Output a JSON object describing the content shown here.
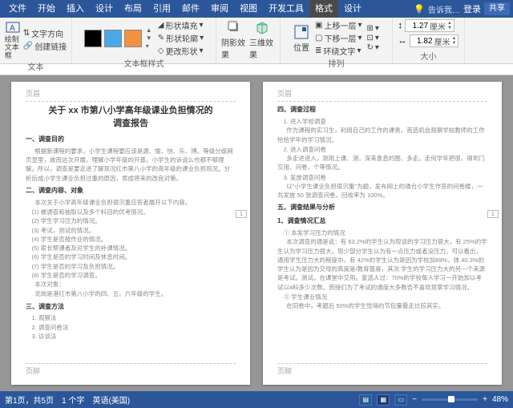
{
  "menu": {
    "tabs": [
      "文件",
      "开始",
      "插入",
      "设计",
      "布局",
      "引用",
      "邮件",
      "审阅",
      "视图",
      "开发工具",
      "格式",
      "设计"
    ],
    "tell": "告诉我…",
    "login": "登录",
    "share": "共享"
  },
  "ribbon": {
    "g1": {
      "btn1": "绘制\n文本框",
      "btn2": "创建链接",
      "txtdir": "文字方向",
      "label": "文本"
    },
    "g2": {
      "label": "文本框样式",
      "fill": "形状填充",
      "outline": "形状轮廓",
      "change": "更改形状"
    },
    "g3": {
      "shadow": "阴影效果",
      "threed": "三维效果"
    },
    "g4": {
      "pos": "位置",
      "up": "上移一层",
      "down": "下移一层",
      "wrap": "环绕文字",
      "label": "排列"
    },
    "g5": {
      "w": "1.27",
      "h": "1.82",
      "unit": "厘米",
      "label": "大小"
    }
  },
  "page1": {
    "hdr": "页眉",
    "ftr": "页脚",
    "title1": "关于 xx 市第八小学高年级课业负担情况的",
    "title2": "调查报告",
    "s1": "一、调查目的",
    "p1": "根据新课程的要求，小学生课程要应该是源、愉、快、乐、博。等级分级网页显里，故而这次开展，理解小学年级的开基。小学生的诉说么也都不够理解。所以，调查是要走进了解现况红市第八小学的高年级的课业负担现况。分析后成小学生课业负担过重的原因，思成将来的改良对策。",
    "s2": "二、调查内容、对象",
    "p2": "本次关于小学高年级课业负担很沉重应答者展开以下内容。",
    "l1": "(1) 被调查和抽取以及多个科目的优考情况。",
    "l2": "(2) 学生学习压力的情况。",
    "l3": "(3) 考试，测试的情况。",
    "l4": "(4) 学生是否按作业的情况。",
    "l5": "(5) 家长帮课者及对学生的补课情况。",
    "l6": "(6) 学生是否的学习时间及休息时间。",
    "l7": "(7) 学生是否的学习及负担情况。",
    "l8": "(8) 学生是否的学习调查。",
    "p3": "本次对象：",
    "p4": "龙岗是港红市第八小学的四、五、六年级的学生。",
    "s3": "三、调查方法",
    "l9": "1. 观察法",
    "l10": "2. 调查问卷法",
    "l11": "3. 访谈法"
  },
  "page2": {
    "hdr": "页眉",
    "ftr": "页脚",
    "s1": "四、调查过程",
    "l1": "1. 进入学校调查",
    "p1": "作为课程的实习生，利用自己的工作的课责，首选机会观察学校教师的工作恰恰学年的学习情况。",
    "l2": "2. 进入调查问卷",
    "p2": "多走进进入，测用上课、测，深来袁息的图、多走。走何学年把很，得到门交用、问卷，个等情况。",
    "l3": "3. 发放调查问卷",
    "p3": "以\"小学生课业负担很沉重\"为题，发布网上的通合小学生作答的问卷楼，一共发放 50 张调查问卷，回收率为 100%。",
    "s2": "五、调查结果与分析",
    "h1": "1、调查情况汇总",
    "l4": "① 本发学习压力的情况",
    "p4": "本次调查的通是说：有 63.2%的学生认为现谈的学习压力很大，有 25%的学生认为学习压力很大，现少部分学生认为有一点压力或者没压力。可以看出，通用学生压力大的程度中，有 42%的学生认为是因为学校加89%，体 40.3%的学生认为是因为交母的高度是/教育基度，其次  学生的学习压力大的另一个来源是考试。测试，在课堂中交用。复选人过：70%的学校每人学习一开始加以考试以4科多少次数。而接们为了考试的通度大多数否不喜欢现掌学习情况。",
    "l5": "② 学生课业情况",
    "p5": "在同卷中，考题后 50%的学生觉得的节包量最走比较其实。"
  },
  "status": {
    "pages": "第1页，共5页",
    "words": "1 个字",
    "lang": "英语(美国)",
    "zoom": "48%"
  }
}
